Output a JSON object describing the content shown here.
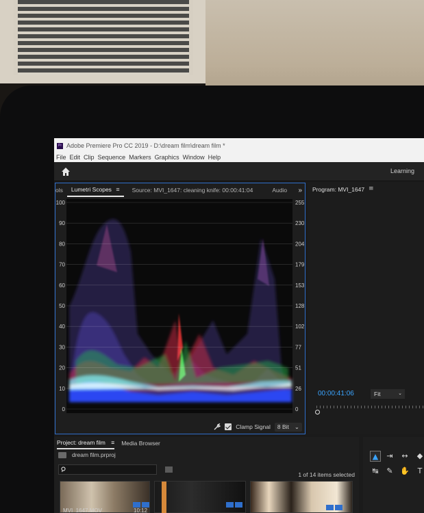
{
  "titlebar": {
    "app_title": "Adobe Premiere Pro CC 2019 - D:\\dream film\\dream film *",
    "logo_text": "Pr"
  },
  "menubar": {
    "items": [
      "File",
      "Edit",
      "Clip",
      "Sequence",
      "Markers",
      "Graphics",
      "Window",
      "Help"
    ]
  },
  "workspace": {
    "learning_label": "Learning"
  },
  "scopes_panel": {
    "tab_partial": "ols",
    "tab_active": "Lumetri Scopes",
    "tab_source": "Source: MVI_1647: cleaning knife: 00:00:41:04",
    "tab_audio": "Audio",
    "more_glyph": "»",
    "menu_glyph": "≡",
    "left_axis": [
      "100",
      "90",
      "80",
      "70",
      "60",
      "50",
      "40",
      "30",
      "20",
      "10",
      "0"
    ],
    "right_axis": [
      "255",
      "230",
      "204",
      "179",
      "153",
      "128",
      "102",
      "77",
      "51",
      "26",
      "0"
    ],
    "clamp_label": "Clamp Signal",
    "bit_depth": "8 Bit",
    "select_arrow": "⌄"
  },
  "program_panel": {
    "title": "Program: MVI_1647",
    "menu_glyph": "≡",
    "timecode": "00:00:41:06",
    "fit_label": "Fit",
    "fit_arrow": "⌄"
  },
  "project_panel": {
    "tab_project": "Project: dream film",
    "menu_glyph": "≡",
    "tab_media": "Media Browser",
    "project_file": "dream film.prproj",
    "items_count": "1 of 14 items selected",
    "clip_label": "MVI_1647.MOV",
    "clip_duration": "10:12"
  },
  "tools": {
    "selection": "▲",
    "track_select": "⇥",
    "ripple": "↔",
    "razor": "◆",
    "slip": "↹",
    "pen": "✎",
    "hand": "✋",
    "type": "T"
  },
  "colors": {
    "accent_blue": "#2f6fcc",
    "timecode_blue": "#3aa4ff",
    "panel_bg": "#1e1e1e"
  }
}
